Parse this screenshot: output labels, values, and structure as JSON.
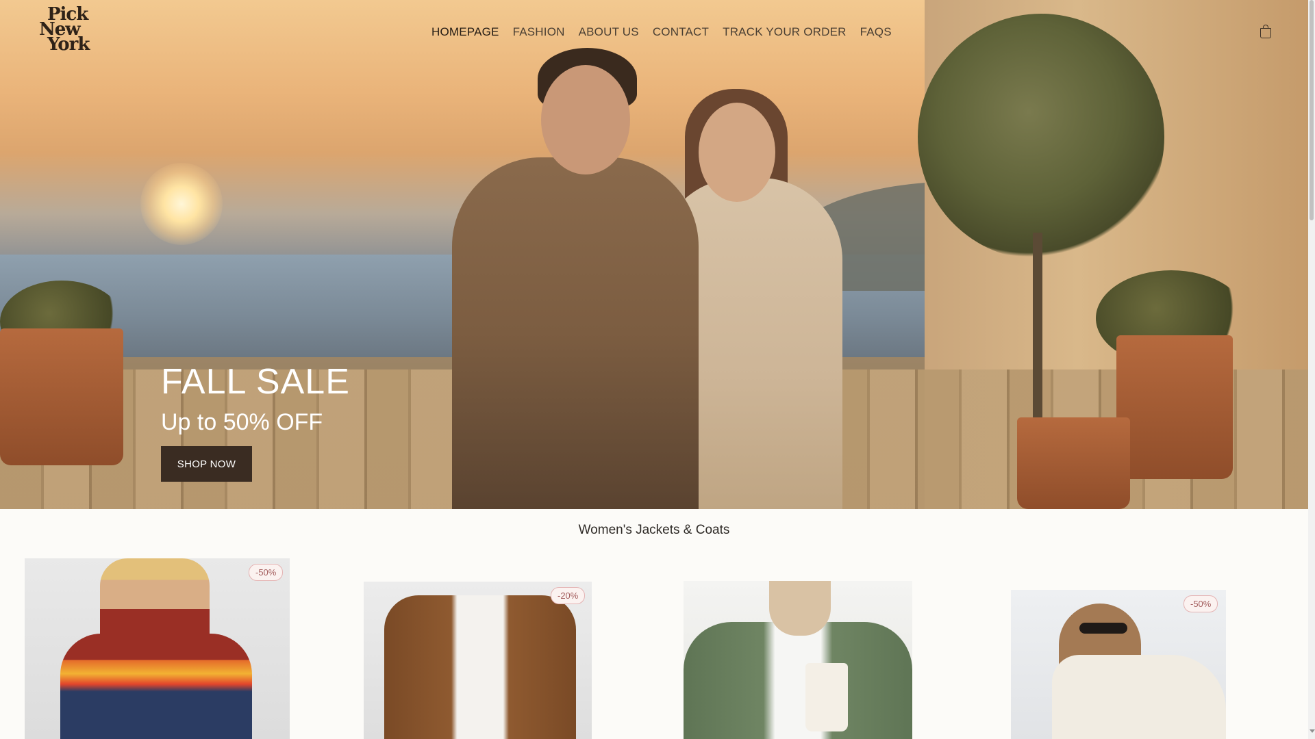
{
  "brand": {
    "logo_lines": [
      "Pick",
      "New",
      "York"
    ]
  },
  "nav": {
    "items": [
      "HOMEPAGE",
      "FASHION",
      "ABOUT US",
      "CONTACT",
      "TRACK YOUR ORDER",
      "FAQS"
    ],
    "active": "HOMEPAGE",
    "cart_icon": "shopping-bag-icon"
  },
  "hero": {
    "title": "FALL SALE",
    "subtitle": "Up to 50% OFF",
    "cta_label": "SHOP NOW"
  },
  "section": {
    "title": "Women's Jackets & Coats"
  },
  "products": [
    {
      "badge": "-50%"
    },
    {
      "badge": "-20%"
    },
    {
      "badge": ""
    },
    {
      "badge": "-50%"
    }
  ],
  "colors": {
    "accent_button": "#3a2c22",
    "badge_text": "#a35d5d",
    "background": "#fcfbf8"
  }
}
